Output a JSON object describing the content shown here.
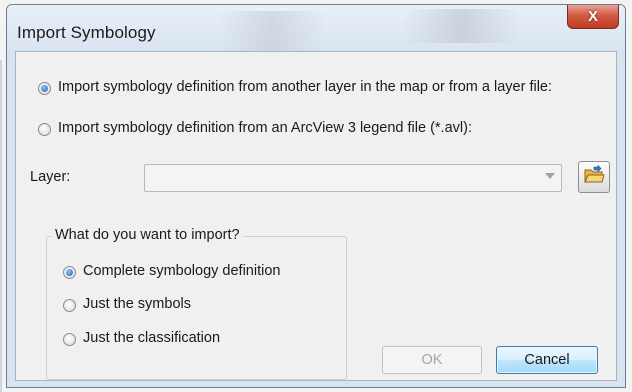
{
  "dialog": {
    "title": "Import Symbology",
    "close_label": "X"
  },
  "source_options": [
    {
      "label": "Import symbology definition from another layer in the map or from a layer file:",
      "checked": true
    },
    {
      "label": "Import symbology definition from an ArcView 3 legend file (*.avl):",
      "checked": false
    }
  ],
  "layer": {
    "label": "Layer:",
    "value": ""
  },
  "import_group": {
    "title": "What do you want to import?",
    "options": [
      {
        "label": "Complete symbology definition",
        "checked": true
      },
      {
        "label": "Just the symbols",
        "checked": false
      },
      {
        "label": "Just the classification",
        "checked": false
      }
    ]
  },
  "buttons": {
    "ok": "OK",
    "ok_enabled": false,
    "cancel": "Cancel"
  },
  "icons": {
    "close": "close-icon",
    "browse": "open-folder-icon",
    "dropdown": "chevron-down-icon"
  },
  "colors": {
    "close_button": "#c23b22",
    "radio_selected": "#1d5fc4",
    "cancel_border": "#3c7fb1"
  }
}
